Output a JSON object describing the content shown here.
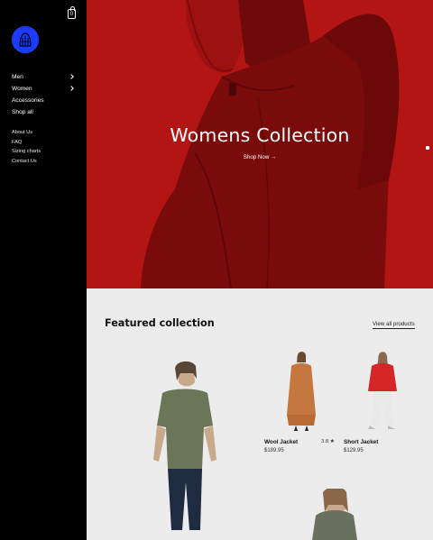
{
  "header": {
    "bag_count": "0"
  },
  "sidebar": {
    "main_nav": [
      {
        "label": "Men",
        "has_submenu": true
      },
      {
        "label": "Women",
        "has_submenu": true
      },
      {
        "label": "Accessories",
        "has_submenu": false
      },
      {
        "label": "Shop all",
        "has_submenu": false
      }
    ],
    "secondary_nav": [
      {
        "label": "About Us"
      },
      {
        "label": "FAQ"
      },
      {
        "label": "Sizing charts"
      },
      {
        "label": "Contact Us"
      }
    ]
  },
  "hero": {
    "title": "Womens Collection",
    "cta": "Shop Now →",
    "bg_color": "#b31515"
  },
  "featured": {
    "title": "Featured collection",
    "view_all": "View all products",
    "products": [
      {
        "name": "Wool Jacket",
        "price": "$189.95",
        "rating": "3.8 ★"
      },
      {
        "name": "Short Jacket",
        "price": "$129.95"
      }
    ]
  },
  "colors": {
    "sidebar_bg": "#000000",
    "logo_blue": "#1b3cff",
    "page_bg": "#ececec"
  }
}
